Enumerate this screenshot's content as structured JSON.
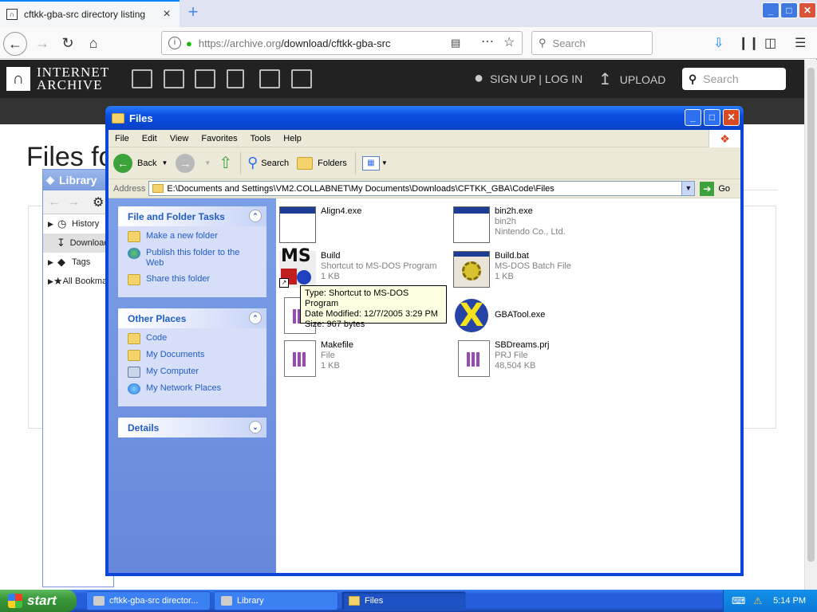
{
  "browser": {
    "tab_title": "cftkk-gba-src directory listing",
    "url_host": "https://archive.org",
    "url_path": "/download/cftkk-gba-src",
    "search_placeholder": "Search"
  },
  "archive": {
    "logo_line1": "INTERNET",
    "logo_line2": "ARCHIVE",
    "signup_login": "SIGN UP | LOG IN",
    "upload": "UPLOAD",
    "search_placeholder": "Search",
    "page_heading": "Files fo"
  },
  "library": {
    "title": "Library",
    "items": [
      {
        "label": "History"
      },
      {
        "label": "Downloads"
      },
      {
        "label": "Tags"
      },
      {
        "label": "All Bookmarks"
      }
    ]
  },
  "explorer": {
    "title": "Files",
    "menu": [
      "File",
      "Edit",
      "View",
      "Favorites",
      "Tools",
      "Help"
    ],
    "toolbar": {
      "back": "Back",
      "search": "Search",
      "folders": "Folders"
    },
    "address_label": "Address",
    "address": "E:\\Documents and Settings\\VM2.COLLABNET\\My Documents\\Downloads\\CFTKK_GBA\\Code\\Files",
    "go": "Go",
    "panels": {
      "tasks_title": "File and Folder Tasks",
      "tasks": [
        "Make a new folder",
        "Publish this folder to the Web",
        "Share this folder"
      ],
      "places_title": "Other Places",
      "places": [
        "Code",
        "My Documents",
        "My Computer",
        "My Network Places"
      ],
      "details_title": "Details"
    },
    "files": [
      {
        "name": "Align4.exe",
        "line2": "",
        "line3": "",
        "icon": "exe-icon"
      },
      {
        "name": "bin2h.exe",
        "line2": "bin2h",
        "line3": "Nintendo Co., Ltd.",
        "icon": "exe-icon"
      },
      {
        "name": "Build",
        "line2": "Shortcut to MS-DOS Program",
        "line3": "1 KB",
        "icon": "msdos-shortcut-icon"
      },
      {
        "name": "Build.bat",
        "line2": "MS-DOS Batch File",
        "line3": "1 KB",
        "icon": "batch-file-icon"
      },
      {
        "name": "",
        "line2": "",
        "line3": "",
        "icon": "document-icon"
      },
      {
        "name": "GBATool.exe",
        "line2": "",
        "line3": "",
        "icon": "gbatool-icon"
      },
      {
        "name": "Makefile",
        "line2": "File",
        "line3": "1 KB",
        "icon": "document-icon"
      },
      {
        "name": "SBDreams.prj",
        "line2": "PRJ File",
        "line3": "48,504 KB",
        "icon": "document-icon"
      }
    ],
    "tooltip": {
      "line1": "Type: Shortcut to MS-DOS Program",
      "line2": "Date Modified: 12/7/2005 3:29 PM",
      "line3": "Size: 967 bytes"
    }
  },
  "taskbar": {
    "start": "start",
    "buttons": [
      {
        "label": "cftkk-gba-src director..."
      },
      {
        "label": "Library"
      },
      {
        "label": "Files"
      }
    ],
    "clock": "5:14 PM"
  },
  "colors": {
    "xp_titlebar": "#0a46d8",
    "xp_taskpane": "#6787dc",
    "archive_header": "#222222",
    "taskbar": "#245edb",
    "start_button": "#3a9a3a"
  }
}
